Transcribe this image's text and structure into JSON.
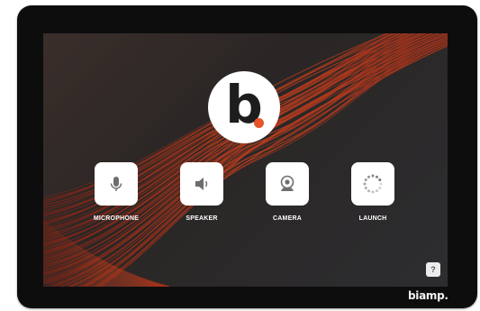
{
  "brand": {
    "logo_letter": "b",
    "accent_color": "#e8542a",
    "device_brand": "biamp."
  },
  "tiles": [
    {
      "label": "MICROPHONE",
      "icon": "microphone-icon"
    },
    {
      "label": "SPEAKER",
      "icon": "speaker-icon"
    },
    {
      "label": "CAMERA",
      "icon": "camera-icon"
    },
    {
      "label": "LAUNCH",
      "icon": "launch-spinner-icon"
    }
  ],
  "help": {
    "label": "?"
  }
}
